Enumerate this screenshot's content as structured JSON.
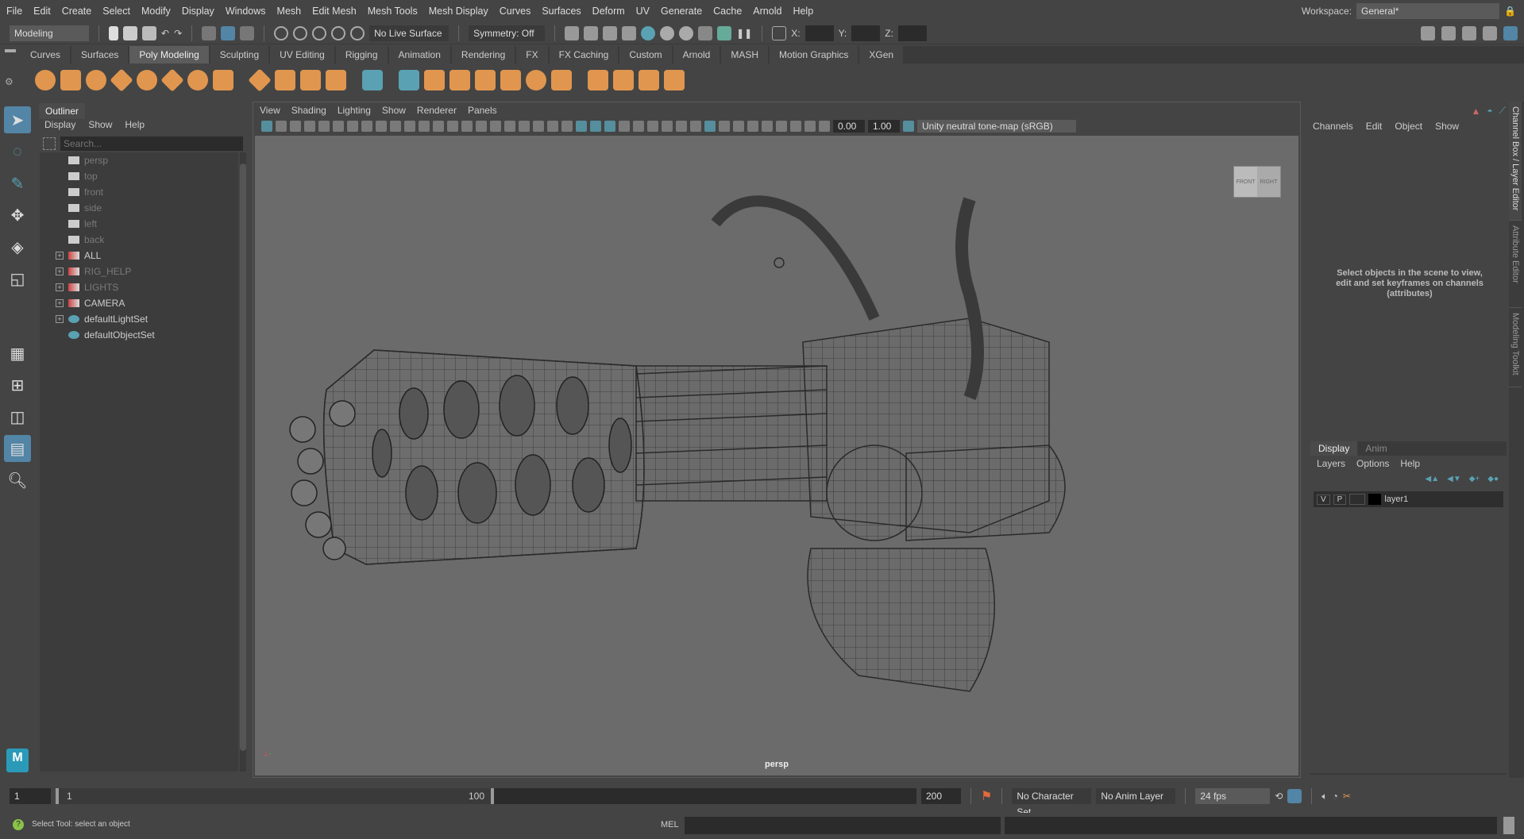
{
  "menubar": {
    "items": [
      "File",
      "Edit",
      "Create",
      "Select",
      "Modify",
      "Display",
      "Windows",
      "Mesh",
      "Edit Mesh",
      "Mesh Tools",
      "Mesh Display",
      "Curves",
      "Surfaces",
      "Deform",
      "UV",
      "Generate",
      "Cache",
      "Arnold",
      "Help"
    ],
    "workspace_label": "Workspace:",
    "workspace_value": "General*"
  },
  "status_line": {
    "mode": "Modeling",
    "live_surface": "No Live Surface",
    "symmetry": "Symmetry: Off",
    "x_label": "X:",
    "y_label": "Y:",
    "z_label": "Z:"
  },
  "shelf": {
    "tabs": [
      "Curves",
      "Surfaces",
      "Poly Modeling",
      "Sculpting",
      "UV Editing",
      "Rigging",
      "Animation",
      "Rendering",
      "FX",
      "FX Caching",
      "Custom",
      "Arnold",
      "MASH",
      "Motion Graphics",
      "XGen"
    ],
    "active_tab": "Poly Modeling",
    "icons": [
      "poly-sphere",
      "poly-cube",
      "poly-cylinder",
      "poly-cone",
      "poly-torus",
      "poly-plane",
      "poly-disc",
      "platonic-solid",
      "super-shape",
      "poly-helix",
      "type",
      "svg",
      "poly-count",
      "bevel",
      "bridge",
      "extrude",
      "combine",
      "separate",
      "smooth",
      "boolean",
      "mirror",
      "multi-cut",
      "target-weld",
      "quad-draw"
    ],
    "accent": "#e0964f",
    "active_color": "#5285a6"
  },
  "toolbox": {
    "tools": [
      "select-tool",
      "lasso-tool",
      "paint-select-tool",
      "move-tool",
      "rotate-tool",
      "scale-tool"
    ]
  },
  "outliner": {
    "title": "Outliner",
    "menu": [
      "Display",
      "Show",
      "Help"
    ],
    "search_placeholder": "Search...",
    "items": [
      {
        "label": "persp",
        "type": "camera",
        "dim": true,
        "expandable": false
      },
      {
        "label": "top",
        "type": "camera",
        "dim": true,
        "expandable": false
      },
      {
        "label": "front",
        "type": "camera",
        "dim": true,
        "expandable": false
      },
      {
        "label": "side",
        "type": "camera",
        "dim": true,
        "expandable": false
      },
      {
        "label": "left",
        "type": "camera",
        "dim": true,
        "expandable": false
      },
      {
        "label": "back",
        "type": "camera",
        "dim": true,
        "expandable": false
      },
      {
        "label": "ALL",
        "type": "group",
        "dim": false,
        "expandable": true
      },
      {
        "label": "RIG_HELP",
        "type": "group",
        "dim": true,
        "expandable": true
      },
      {
        "label": "LIGHTS",
        "type": "group",
        "dim": true,
        "expandable": true
      },
      {
        "label": "CAMERA",
        "type": "group",
        "dim": false,
        "expandable": true
      },
      {
        "label": "defaultLightSet",
        "type": "set",
        "dim": false,
        "expandable": true
      },
      {
        "label": "defaultObjectSet",
        "type": "set",
        "dim": false,
        "expandable": false
      }
    ]
  },
  "viewport": {
    "menu": [
      "View",
      "Shading",
      "Lighting",
      "Show",
      "Renderer",
      "Panels"
    ],
    "exposure": "0.00",
    "gamma": "1.00",
    "color_space": "Unity neutral tone-map (sRGB)",
    "camera_label": "persp",
    "viewcube": {
      "front": "FRONT",
      "right": "RIGHT"
    }
  },
  "channel_box": {
    "menu": [
      "Channels",
      "Edit",
      "Object",
      "Show"
    ],
    "hint": "Select objects in the scene to view, edit and set keyframes on channels (attributes)"
  },
  "layer_editor": {
    "tabs": [
      "Display",
      "Anim"
    ],
    "menu": [
      "Layers",
      "Options",
      "Help"
    ],
    "layers": [
      {
        "v": "V",
        "p": "P",
        "name": "layer1"
      }
    ]
  },
  "side_tabs": [
    "Channel Box / Layer Editor",
    "Attribute Editor",
    "Modeling Toolkit"
  ],
  "timeline": {
    "current": "1",
    "range_start": "1",
    "range_end": "100",
    "anim_end": "200",
    "character_set": "No Character Set",
    "anim_layer": "No Anim Layer",
    "fps": "24 fps"
  },
  "command": {
    "status": "Select Tool: select an object",
    "lang": "MEL"
  },
  "app_logo": "M"
}
